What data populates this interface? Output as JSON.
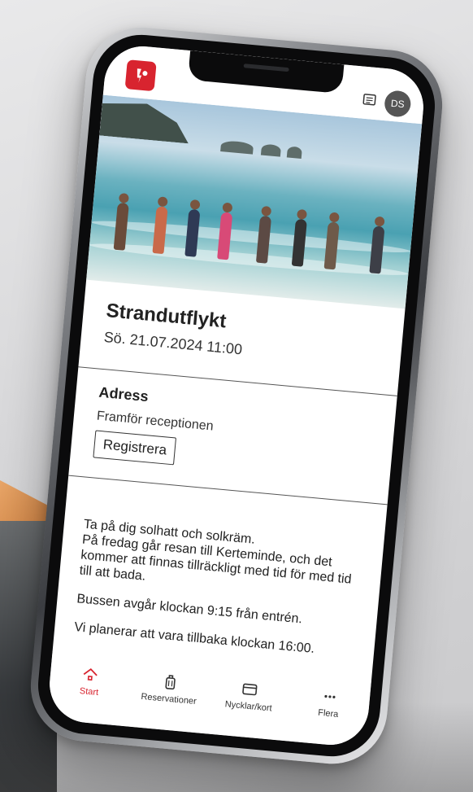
{
  "header": {
    "logo_icon": "app-logo-icon",
    "messages_icon": "messages-icon",
    "avatar_initials": "DS"
  },
  "event": {
    "title": "Strandutflykt",
    "datetime": "Sö. 21.07.2024 11:00"
  },
  "address": {
    "heading": "Adress",
    "value": "Framför receptionen",
    "register_label": "Registrera"
  },
  "description": {
    "line1": "Ta på dig solhatt och solkräm.",
    "line2": "På fredag går resan till Kerteminde, och det kommer att finnas tillräckligt med tid för med tid till att bada.",
    "line3": "Bussen avgår klockan 9:15 från entrén.",
    "line4": "Vi planerar att vara tillbaka klockan 16:00."
  },
  "nav": {
    "items": [
      {
        "label": "Start",
        "icon": "home-icon",
        "active": true
      },
      {
        "label": "Reservationer",
        "icon": "luggage-icon",
        "active": false
      },
      {
        "label": "Nycklar/kort",
        "icon": "card-icon",
        "active": false
      },
      {
        "label": "Flera",
        "icon": "more-icon",
        "active": false
      }
    ]
  },
  "colors": {
    "accent": "#d8242f"
  }
}
